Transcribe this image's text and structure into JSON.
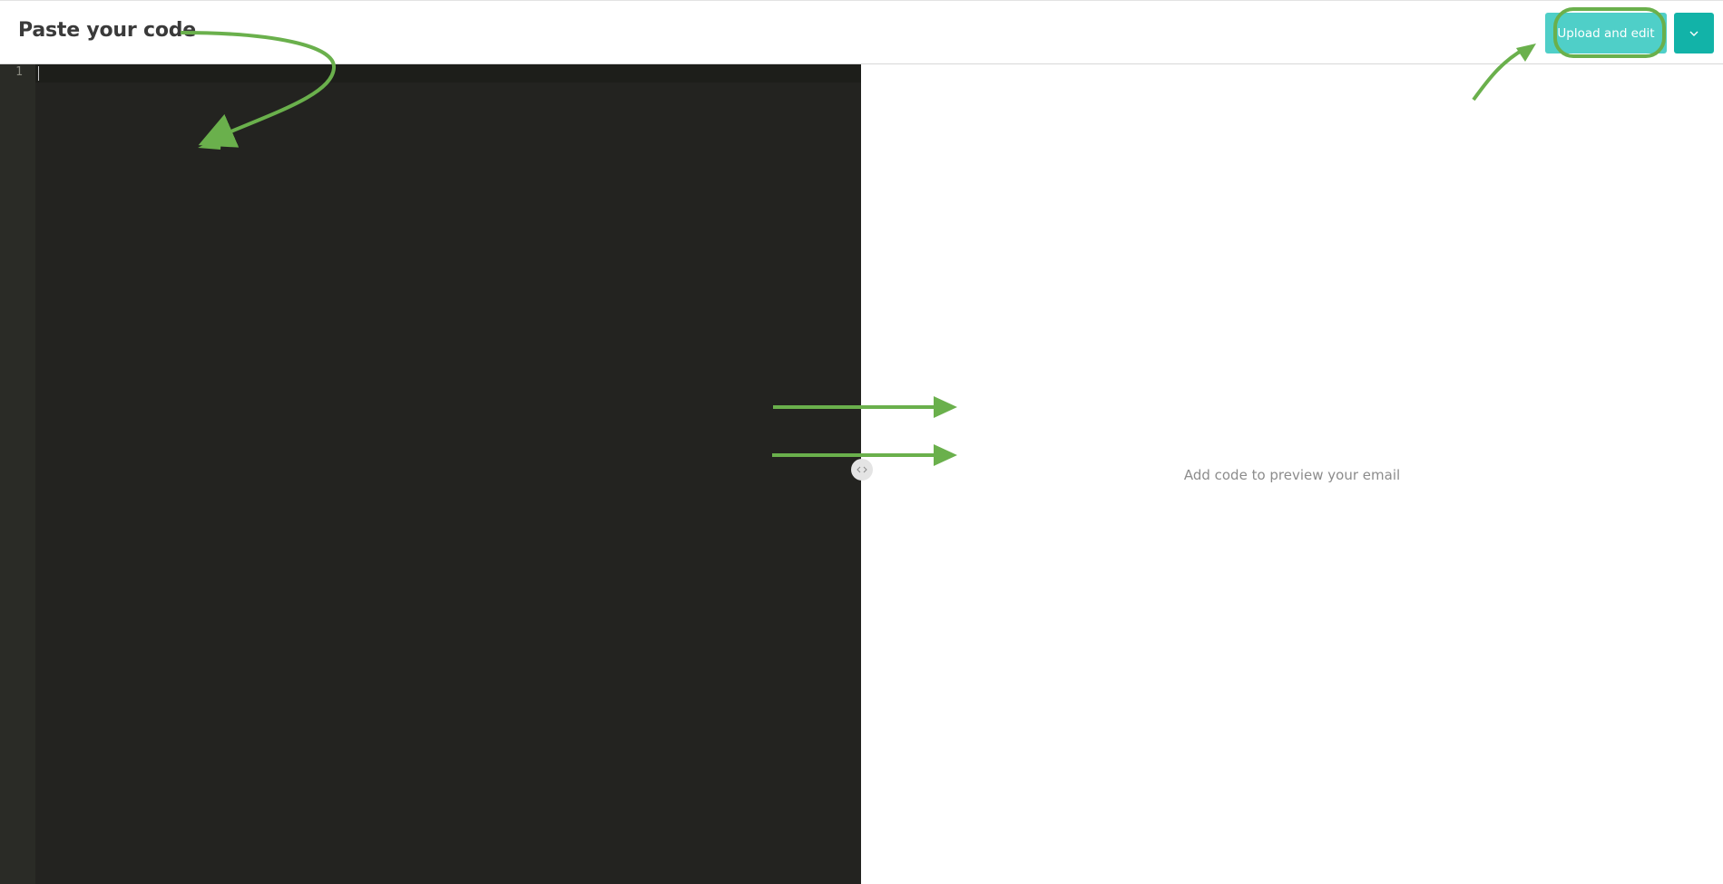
{
  "header": {
    "title": "Paste your code",
    "upload_button_label": "Upload and edit",
    "dropdown_icon": "chevron-down-icon"
  },
  "editor": {
    "line_numbers": [
      "1"
    ]
  },
  "preview": {
    "empty_message": "Add code to preview your email",
    "resize_icon": "drag-handle-icon"
  },
  "colors": {
    "accent": "#4fcfc8",
    "accent_dark": "#12b3a8",
    "editor_bg": "#232320",
    "annotation_arrow": "#6ab04c"
  }
}
